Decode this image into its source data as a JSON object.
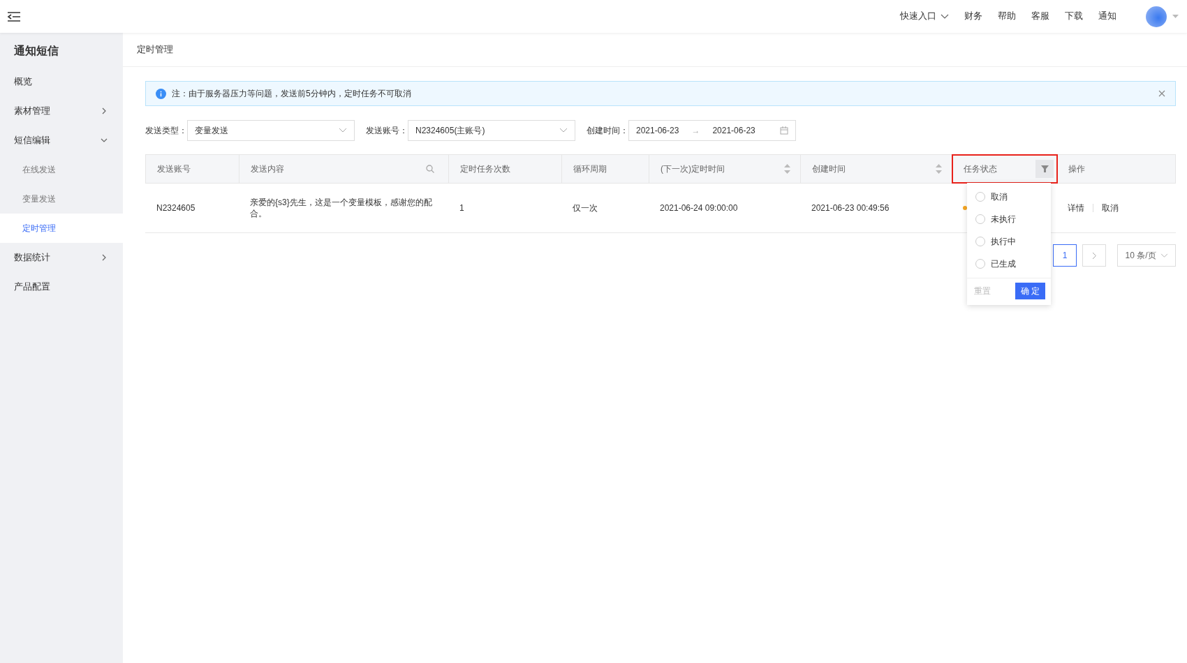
{
  "topbar": {
    "links": [
      {
        "label": "快速入口",
        "kind": "dropdown"
      },
      {
        "label": "财务",
        "kind": "link"
      },
      {
        "label": "帮助",
        "kind": "link"
      },
      {
        "label": "客服",
        "kind": "link"
      },
      {
        "label": "下载",
        "kind": "link"
      },
      {
        "label": "通知",
        "kind": "link"
      }
    ]
  },
  "sidebar": {
    "title": "通知短信",
    "items": [
      {
        "label": "概览",
        "selected": false,
        "kind": "page"
      },
      {
        "label": "素材管理",
        "selected": false,
        "expanded": false,
        "kind": "group"
      },
      {
        "label": "短信编辑",
        "selected": false,
        "expanded": true,
        "kind": "group",
        "children": [
          {
            "label": "在线发送",
            "selected": false
          },
          {
            "label": "变量发送",
            "selected": false
          },
          {
            "label": "定时管理",
            "selected": true
          }
        ]
      },
      {
        "label": "数据统计",
        "selected": false,
        "expanded": false,
        "kind": "group"
      },
      {
        "label": "产品配置",
        "selected": false,
        "kind": "page"
      }
    ]
  },
  "breadcrumb": "定时管理",
  "alert": {
    "text": "注：由于服务器压力等问题，发送前5分钟内，定时任务不可取消"
  },
  "filters": {
    "type": {
      "label": "发送类型：",
      "value": "变量发送"
    },
    "account": {
      "label": "发送账号：",
      "value": "N2324605(主账号)"
    },
    "created": {
      "label": "创建时间：",
      "start": "2021-06-23",
      "separator": "→",
      "end": "2021-06-23"
    }
  },
  "table": {
    "columns": [
      {
        "label": "发送账号",
        "kind": "plain",
        "highlighted": false
      },
      {
        "label": "发送内容",
        "kind": "search",
        "highlighted": false
      },
      {
        "label": "定时任务次数",
        "kind": "plain",
        "highlighted": false
      },
      {
        "label": "循环周期",
        "kind": "plain",
        "highlighted": false
      },
      {
        "label": "(下一次)定时时间",
        "kind": "sort",
        "highlighted": false
      },
      {
        "label": "创建时间",
        "kind": "sort",
        "highlighted": false
      },
      {
        "label": "任务状态",
        "kind": "filter",
        "highlighted": true
      },
      {
        "label": "操作",
        "kind": "plain",
        "highlighted": false
      }
    ],
    "rows": [
      {
        "account": "N2324605",
        "content": "亲爱的{s3}先生，这是一个变量模板，感谢您的配合。",
        "count": "1",
        "cycle": "仅一次",
        "next_time": "2021-06-24 09:00:00",
        "created": "2021-06-23 00:49:56",
        "color": "#f5a623",
        "actions": [
          "详情",
          "取消"
        ]
      }
    ]
  },
  "filter_menu": {
    "options": [
      {
        "label": "取消",
        "checked": false
      },
      {
        "label": "未执行",
        "checked": false
      },
      {
        "label": "执行中",
        "checked": false
      },
      {
        "label": "已生成",
        "checked": false
      }
    ],
    "reset": "重置",
    "confirm": "确 定"
  },
  "pagination": {
    "pages": [
      {
        "label": "1",
        "selected": true
      }
    ],
    "page_size": "10 条/页"
  }
}
